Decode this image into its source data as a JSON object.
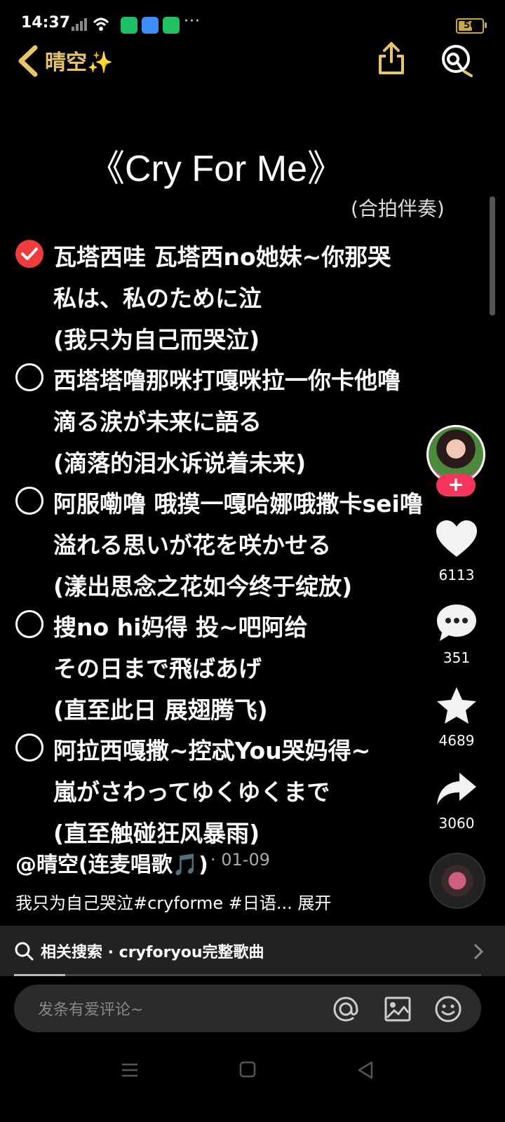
{
  "status_bar": {
    "time": "14:37",
    "battery": "56",
    "more": "···"
  },
  "nav": {
    "title": "晴空✨"
  },
  "song": {
    "title": "《Cry For Me》",
    "subtitle": "(合拍伴奏)"
  },
  "lyrics": [
    {
      "checked": true,
      "line1": "瓦塔西哇 瓦塔西no她妹~你那哭",
      "line2": "私は、私のために泣",
      "line3": "(我只为自己而哭泣)"
    },
    {
      "checked": false,
      "line1": "西塔塔噜那咪打嘎咪拉一你卡他噜",
      "line2": "滴る涙が未来に語る",
      "line3": "(滴落的泪水诉说着未来)"
    },
    {
      "checked": false,
      "line1": "阿服嘞噜 哦摸一嘎哈娜哦撒卡sei噜",
      "line2": "溢れる思いが花を咲かせる",
      "line3": "(漾出思念之花如今终于绽放)"
    },
    {
      "checked": false,
      "line1": "搜no hi妈得 投~吧阿给",
      "line2": "その日まで飛ばあげ",
      "line3": "(直至此日 展翅腾飞)"
    },
    {
      "checked": false,
      "line1": "阿拉西嘎撒~控忒You哭妈得~",
      "line2": "嵐がさわってゆくゆくまで",
      "line3": "(直至触碰狂风暴雨)"
    }
  ],
  "rail": {
    "likes": "6113",
    "comments": "351",
    "favorites": "4689",
    "shares": "3060",
    "follow": "+"
  },
  "post": {
    "author": "@晴空(连麦唱歌🎵)",
    "date": "· 01-09",
    "caption": "我只为自己哭泣#cryforme #日语... 展开"
  },
  "related": {
    "text": "相关搜索 · cryforyou完整歌曲"
  },
  "progress": 0.11,
  "comment": {
    "placeholder": "发条有爱评论~"
  }
}
